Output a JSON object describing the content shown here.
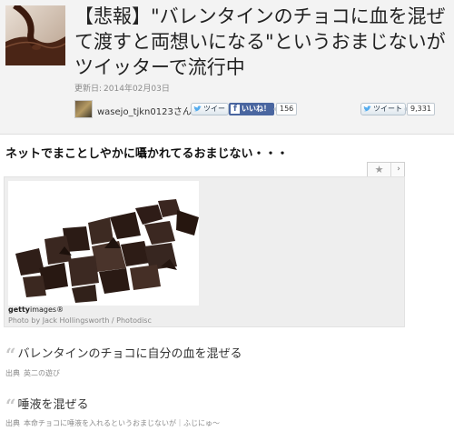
{
  "article": {
    "title": "【悲報】\"バレンタインのチョコに血を混ぜて渡すと両想いになる\"というおまじないがツイッターで流行中",
    "updated_label": "更新日:",
    "updated_date": "2014年02月03日"
  },
  "author": {
    "name": "wasejo_tjkn0123",
    "suffix": "さん"
  },
  "share": {
    "tweet_label_left": "ツイー",
    "like_label": "いいね！",
    "like_count": "156",
    "tweet_label_right": "ツイート",
    "tweet_count": "9,331"
  },
  "section": {
    "heading": "ネットでまことしやかに囁かれてるおまじない・・・"
  },
  "image_card": {
    "getty_brand": "getty",
    "getty_suffix": "images",
    "getty_mark": "®",
    "credit": "Photo by Jack Hollingsworth / Photodisc"
  },
  "items": [
    {
      "quote_mark": "“",
      "text": "バレンタインのチョコに自分の血を混ぜる",
      "source_label": "出典",
      "source_text": "英二の遊び"
    },
    {
      "quote_mark": "“",
      "text": "唾液を混ぜる",
      "source_label": "出典",
      "source_text": "本命チョコに唾液を入れるというおまじないが｜ふじにゅ～"
    }
  ],
  "colors": {
    "header_bg": "#f3f3f3",
    "facebook": "#4a66a0",
    "twitter_bird": "#55acee"
  }
}
